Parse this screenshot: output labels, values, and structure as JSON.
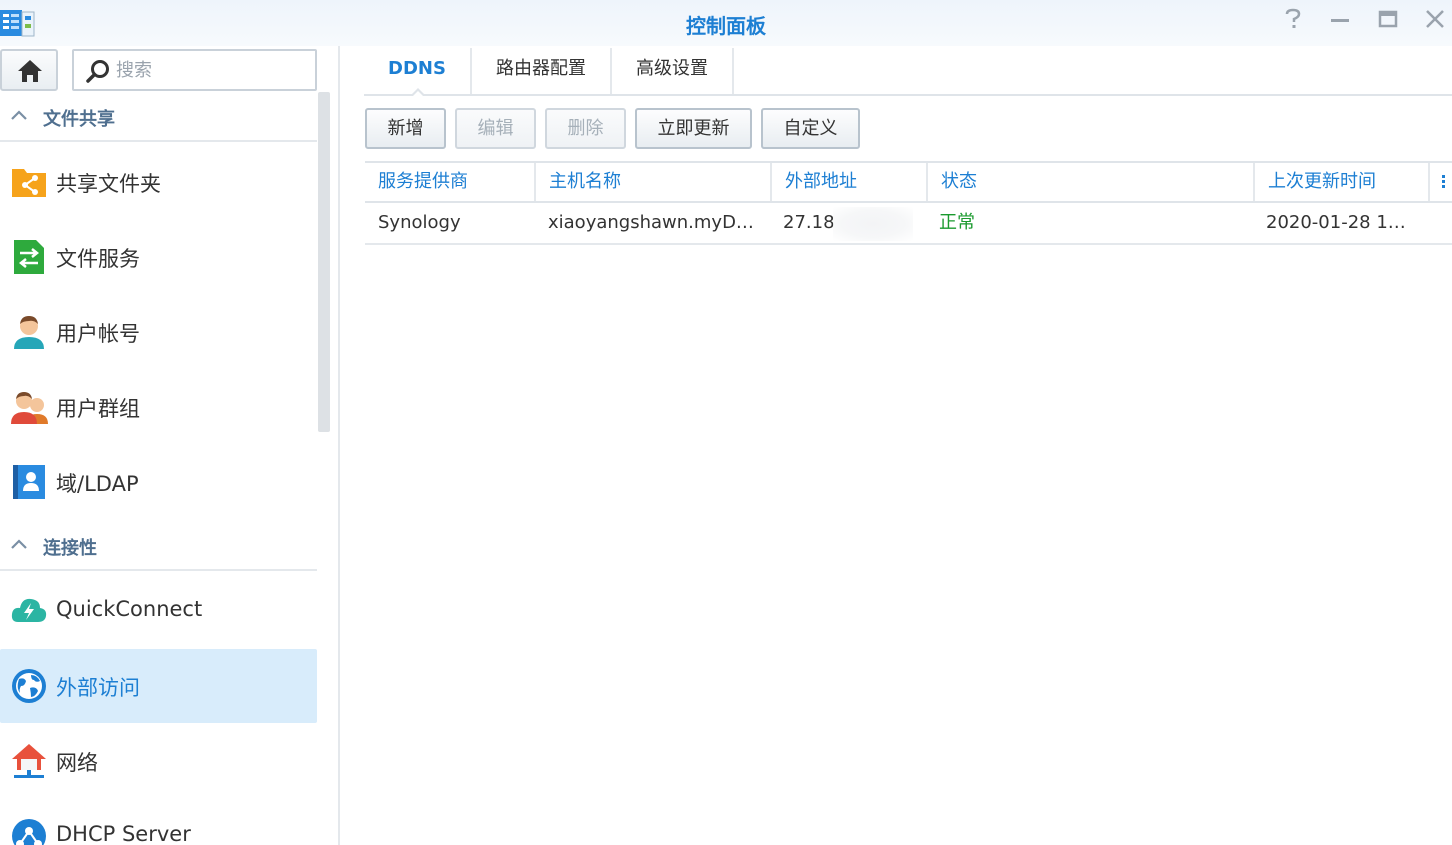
{
  "window": {
    "title": "控制面板"
  },
  "sidebar": {
    "search_placeholder": "搜索",
    "sections": [
      {
        "label": "文件共享"
      },
      {
        "label": "连接性"
      }
    ],
    "items": [
      {
        "label": "共享文件夹",
        "icon": "share-folder-icon"
      },
      {
        "label": "文件服务",
        "icon": "file-services-icon"
      },
      {
        "label": "用户帐号",
        "icon": "user-icon"
      },
      {
        "label": "用户群组",
        "icon": "user-group-icon"
      },
      {
        "label": "域/LDAP",
        "icon": "domain-ldap-icon"
      },
      {
        "label": "QuickConnect",
        "icon": "quickconnect-icon"
      },
      {
        "label": "外部访问",
        "icon": "external-access-icon",
        "active": true
      },
      {
        "label": "网络",
        "icon": "network-icon"
      },
      {
        "label": "DHCP Server",
        "icon": "dhcp-server-icon"
      }
    ]
  },
  "tabs": [
    {
      "label": "DDNS",
      "active": true
    },
    {
      "label": "路由器配置"
    },
    {
      "label": "高级设置"
    }
  ],
  "toolbar": {
    "add": "新增",
    "edit": "编辑",
    "delete": "删除",
    "update_now": "立即更新",
    "customize": "自定义"
  },
  "table": {
    "columns": [
      "服务提供商",
      "主机名称",
      "外部地址",
      "状态",
      "上次更新时间"
    ],
    "rows": [
      {
        "provider": "Synology",
        "hostname": "xiaoyangshawn.myD…",
        "external_address": "27.18",
        "status": "正常",
        "last_update": "2020-01-28 1…"
      }
    ]
  },
  "colors": {
    "accent": "#1d7fd3",
    "status_ok": "#1a9a2e",
    "active_bg": "#d8ecfb"
  }
}
